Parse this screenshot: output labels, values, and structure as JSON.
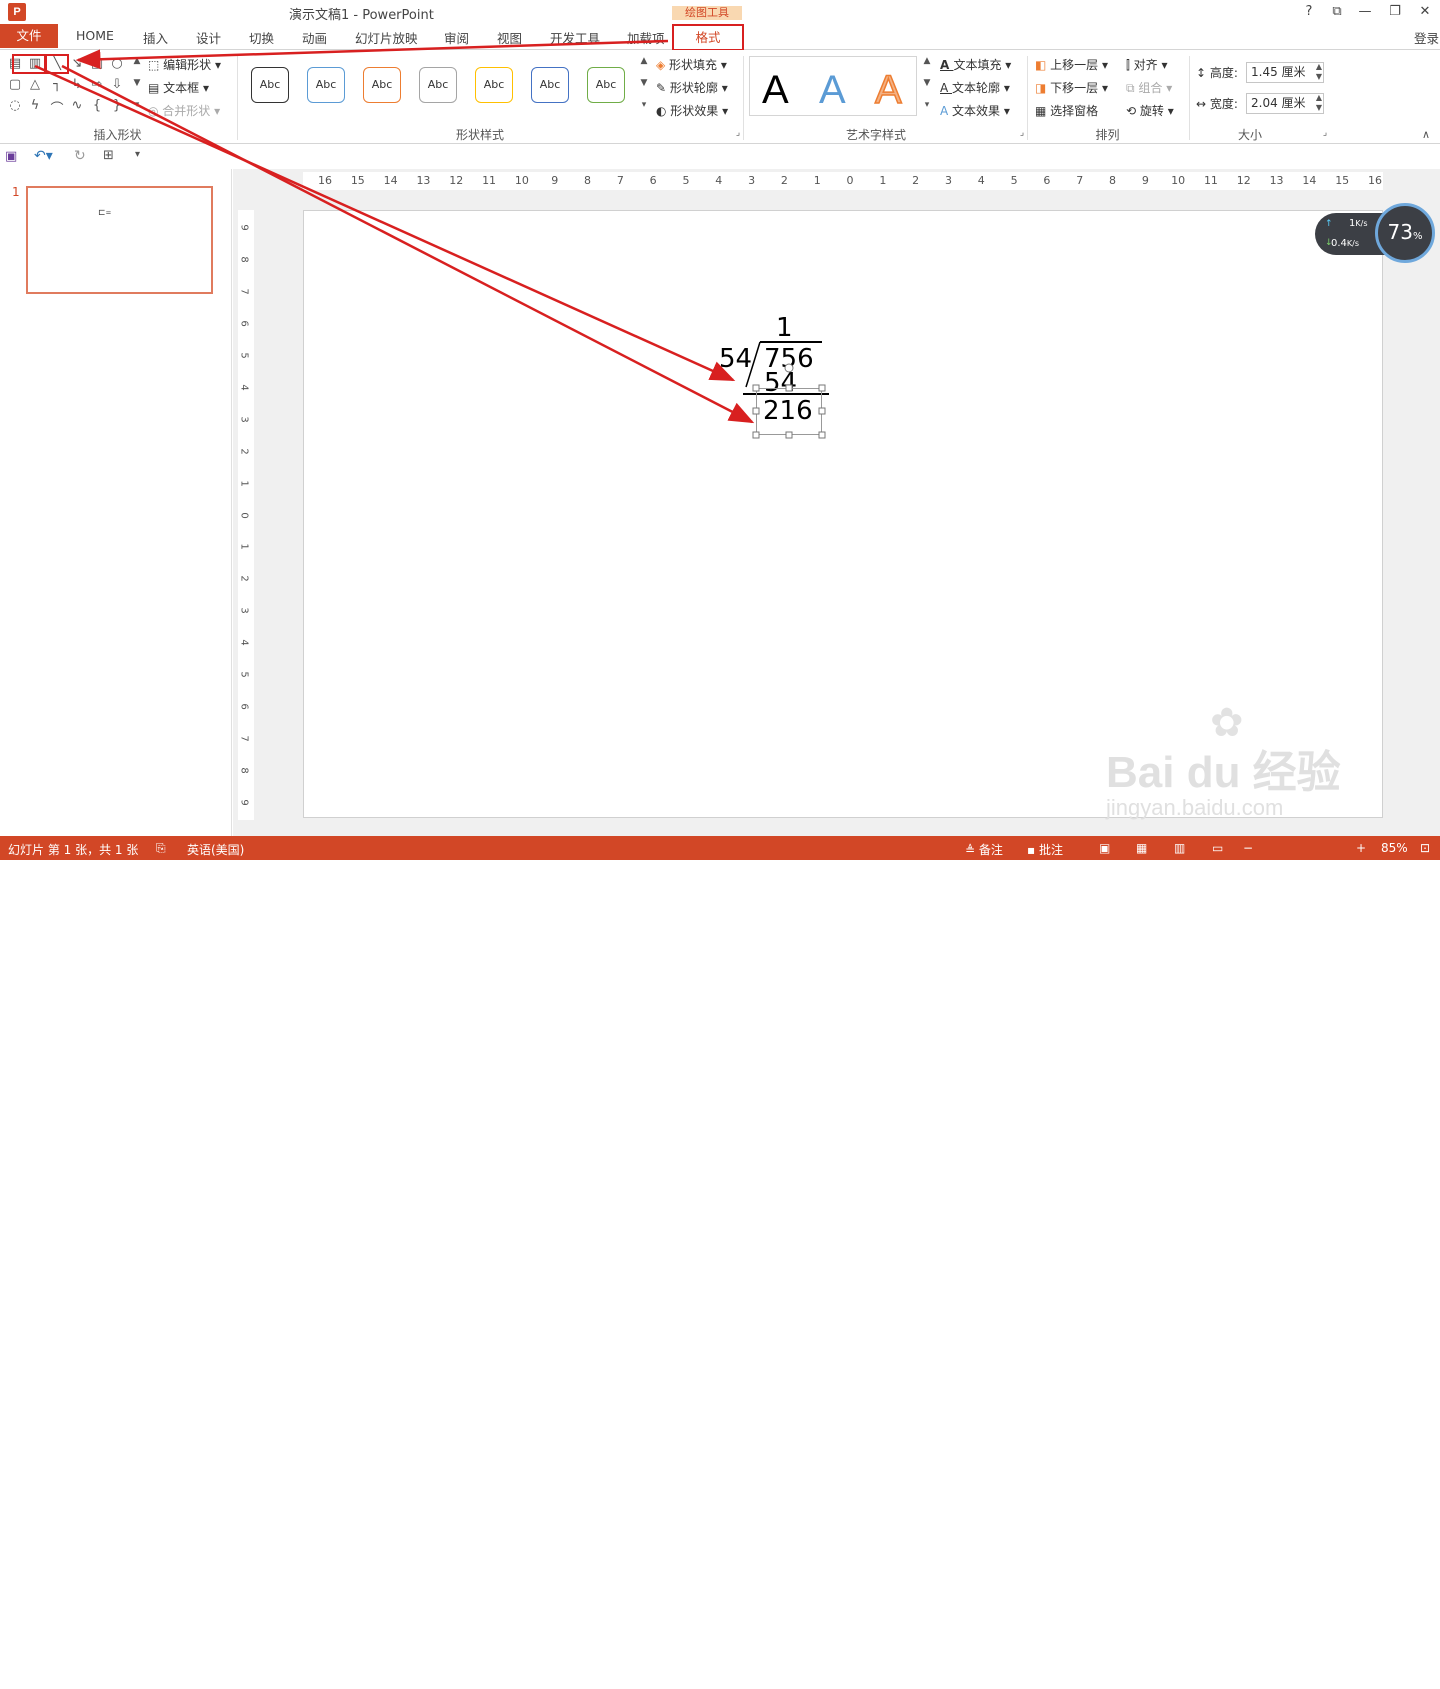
{
  "window": {
    "title": "演示文稿1 - PowerPoint",
    "app_icon": "P",
    "help": "?",
    "ribbon_display": "⧉",
    "minimize": "—",
    "restore": "❐",
    "close": "✕",
    "signin": "登录"
  },
  "tabs": {
    "file": "文件",
    "items": [
      "HOME",
      "插入",
      "设计",
      "切换",
      "动画",
      "幻灯片放映",
      "审阅",
      "视图",
      "开发工具",
      "加载项"
    ],
    "contextual_group": "绘图工具",
    "format": "格式"
  },
  "ribbon": {
    "insert_shapes": {
      "label": "插入形状",
      "edit_shape": "编辑形状",
      "text_box": "文本框",
      "merge_shapes": "合并形状"
    },
    "shape_styles": {
      "label": "形状样式",
      "preset_text": "Abc",
      "preset_colors": [
        "#333333",
        "#5b9bd5",
        "#ed7d31",
        "#a5a5a5",
        "#ffc000",
        "#4472c4",
        "#70ad47"
      ],
      "fill": "形状填充",
      "outline": "形状轮廓",
      "effects": "形状效果"
    },
    "wordart": {
      "label": "艺术字样式",
      "letter": "A",
      "text_fill": "文本填充",
      "text_outline": "文本轮廓",
      "text_effects": "文本效果"
    },
    "arrange": {
      "label": "排列",
      "bring_forward": "上移一层",
      "send_backward": "下移一层",
      "selection_pane": "选择窗格",
      "align": "对齐",
      "group": "组合",
      "rotate": "旋转"
    },
    "size": {
      "label": "大小",
      "height_label": "高度:",
      "height_value": "1.45 厘米",
      "width_label": "宽度:",
      "width_value": "2.04 厘米"
    }
  },
  "qat": {
    "save": "save-icon",
    "undo": "undo-icon",
    "redo": "redo-icon",
    "present": "present-icon"
  },
  "thumbs": {
    "slide_number": "1"
  },
  "ruler": {
    "h_labels": [
      "16",
      "15",
      "14",
      "13",
      "12",
      "11",
      "10",
      "9",
      "8",
      "7",
      "6",
      "5",
      "4",
      "3",
      "2",
      "1",
      "0",
      "1",
      "2",
      "3",
      "4",
      "5",
      "6",
      "7",
      "8",
      "9",
      "10",
      "11",
      "12",
      "13",
      "14",
      "15",
      "16"
    ],
    "v_labels": [
      "9",
      "8",
      "7",
      "6",
      "5",
      "4",
      "3",
      "2",
      "1",
      "0",
      "1",
      "2",
      "3",
      "4",
      "5",
      "6",
      "7",
      "8",
      "9"
    ]
  },
  "slide": {
    "quotient": "1",
    "divisor": "54",
    "dividend": "756",
    "product": "54",
    "remainder": "216"
  },
  "net_widget": {
    "upload": "1",
    "upload_unit": "K/s",
    "download": "0.4",
    "download_unit": "K/s",
    "cpu": "73",
    "cpu_unit": "%"
  },
  "status": {
    "slide_info": "幻灯片 第 1 张，共 1 张",
    "language": "英语(美国)",
    "notes": "备注",
    "comments": "批注",
    "zoom": "85%"
  },
  "watermark": {
    "brand": "Bai du 经验",
    "url": "jingyan.baidu.com"
  },
  "colors": {
    "accent": "#d24726",
    "highlight": "#d82020"
  }
}
